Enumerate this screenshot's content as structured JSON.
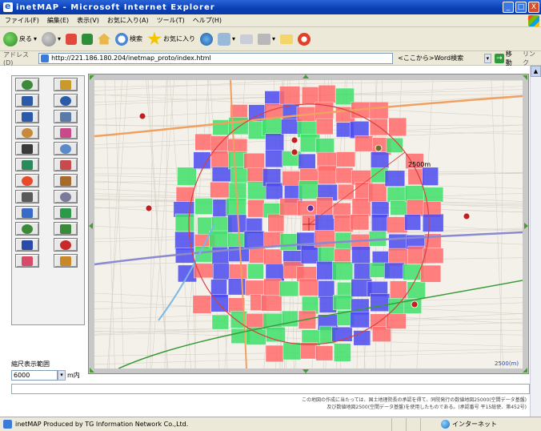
{
  "window": {
    "title": "inetMAP - Microsoft Internet Explorer",
    "controls": [
      "_",
      "□",
      "X"
    ]
  },
  "menu": [
    "ファイル(F)",
    "編集(E)",
    "表示(V)",
    "お気に入り(A)",
    "ツール(T)",
    "ヘルプ(H)"
  ],
  "toolbar": {
    "back_label": "戻る",
    "search_label": "検索",
    "favorites_label": "お気に入り"
  },
  "address": {
    "label": "アドレス(D)",
    "url": "http://221.186.180.204/inetmap_proto/index.html",
    "links_note": "<ここから>Word検索",
    "go_label": "移動",
    "links_label": "リンク"
  },
  "tools": [
    {
      "name": "map-tool-1-icon"
    },
    {
      "name": "pencil-icon"
    },
    {
      "name": "zoom-in-icon"
    },
    {
      "name": "zoom-out-icon"
    },
    {
      "name": "zoom-area-icon"
    },
    {
      "name": "window-icon"
    },
    {
      "name": "hand-pan-icon"
    },
    {
      "name": "chart-icon"
    },
    {
      "name": "binoculars-icon"
    },
    {
      "name": "document-icon"
    },
    {
      "name": "layers-icon"
    },
    {
      "name": "pie-icon"
    },
    {
      "name": "color-grid-icon"
    },
    {
      "name": "book-icon"
    },
    {
      "name": "eraser-icon"
    },
    {
      "name": "copy-icon"
    },
    {
      "name": "music-icon"
    },
    {
      "name": "edit-doc-icon"
    },
    {
      "name": "network-icon"
    },
    {
      "name": "lines-icon"
    },
    {
      "name": "info-icon"
    },
    {
      "name": "select-icon"
    },
    {
      "name": "target-icon"
    },
    {
      "name": "table-icon"
    }
  ],
  "scale": {
    "label": "縮尺表示範囲",
    "value": "6000",
    "unit": "m内"
  },
  "map": {
    "radius_label": "2500m",
    "scale_label": "2500(m)"
  },
  "copyright": {
    "line1": "この地図の作成に当たっては、国土地理院長の承認を得て、同院発行の数値地図25000(空間データ基盤)",
    "line2": "及び数値地図2500(空間データ基盤)を使用したものである。(承認番号 平15総使、第452号)"
  },
  "status": {
    "text": "inetMAP Produced by TG Information Network Co.,Ltd.",
    "zone": "インターネット"
  }
}
